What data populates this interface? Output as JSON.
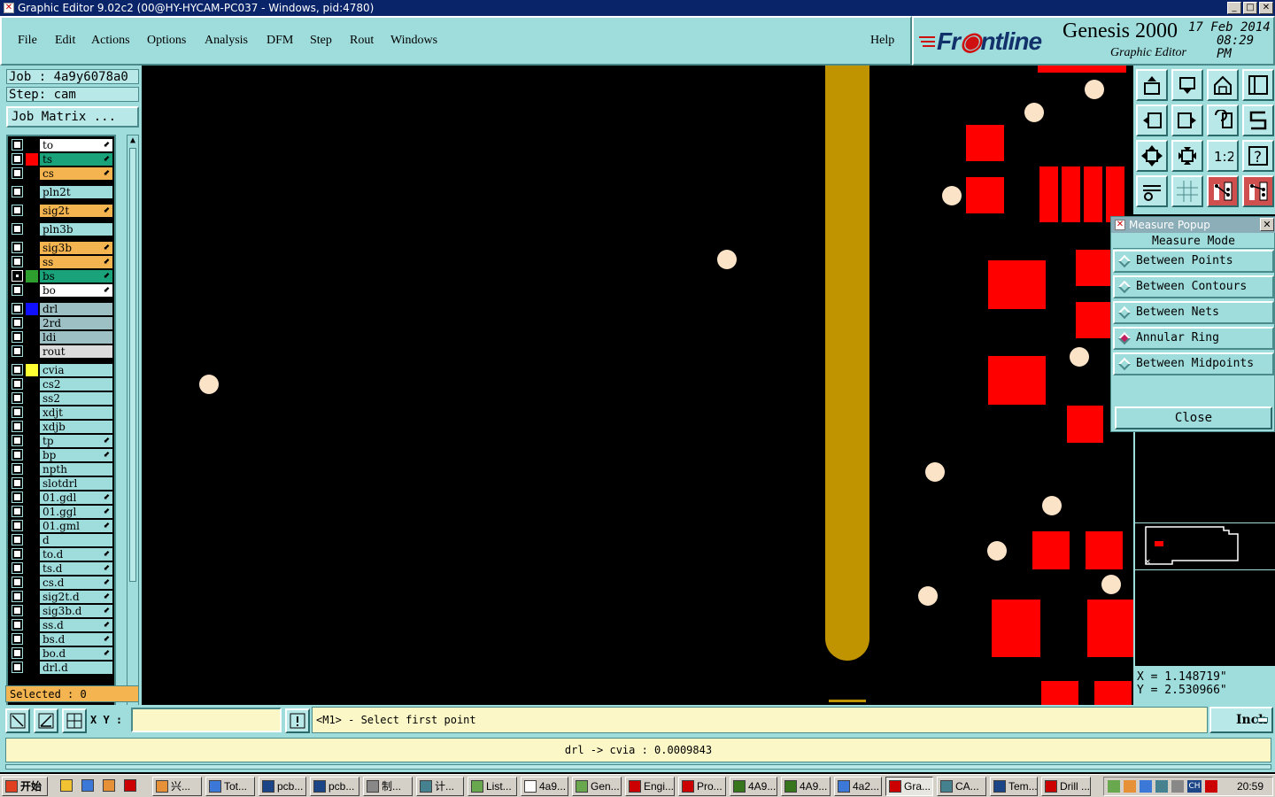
{
  "window": {
    "title": "Graphic Editor 9.02c2 (00@HY-HYCAM-PC037 - Windows, pid:4780)"
  },
  "menu": [
    "File",
    "Edit",
    "Actions",
    "Options",
    "Analysis",
    "DFM",
    "Step",
    "Rout",
    "Windows"
  ],
  "help": "Help",
  "brand": {
    "logo_a": "Fr",
    "logo_b": "ntline",
    "product": "Genesis 2000",
    "subtitle": "Graphic Editor",
    "date": "17 Feb 2014",
    "time": "08:29 PM"
  },
  "job": {
    "job_label": "Job : 4a9y6078a0",
    "step_label": "Step: cam",
    "matrix_button": "Job Matrix ..."
  },
  "layers": [
    {
      "name": "to",
      "color": "#ffffff",
      "swatch": "",
      "arrow": true
    },
    {
      "name": "ts",
      "color": "#1aa37a",
      "swatch": "#ff0000",
      "arrow": true
    },
    {
      "name": "cs",
      "color": "#f4b550",
      "swatch": "",
      "arrow": true
    },
    {
      "name": "pln2t",
      "color": "#9fdcdc",
      "swatch": "",
      "arrow": false
    },
    {
      "name": "sig2t",
      "color": "#f4b550",
      "swatch": "",
      "arrow": true
    },
    {
      "name": "pln3b",
      "color": "#9fdcdc",
      "swatch": "",
      "arrow": false
    },
    {
      "name": "sig3b",
      "color": "#f4b550",
      "swatch": "",
      "arrow": true
    },
    {
      "name": "ss",
      "color": "#f4b550",
      "swatch": "",
      "arrow": true
    },
    {
      "name": "bs",
      "color": "#1aa37a",
      "swatch": "#2e9e2e",
      "arrow": true,
      "checked": true
    },
    {
      "name": "bo",
      "color": "#ffffff",
      "swatch": "",
      "arrow": true
    },
    {
      "name": "drl",
      "color": "#9cc0c4",
      "swatch": "#1010ff",
      "arrow": false
    },
    {
      "name": "2rd",
      "color": "#9cc0c4",
      "swatch": "",
      "arrow": false
    },
    {
      "name": "ldi",
      "color": "#9cc0c4",
      "swatch": "",
      "arrow": false
    },
    {
      "name": "rout",
      "color": "#dcdcdc",
      "swatch": "",
      "arrow": false
    },
    {
      "name": "cvia",
      "color": "#9fdcdc",
      "swatch": "#ffff33",
      "arrow": false
    },
    {
      "name": "cs2",
      "color": "#9fdcdc",
      "swatch": "",
      "arrow": false
    },
    {
      "name": "ss2",
      "color": "#9fdcdc",
      "swatch": "",
      "arrow": false
    },
    {
      "name": "xdjt",
      "color": "#9fdcdc",
      "swatch": "",
      "arrow": false
    },
    {
      "name": "xdjb",
      "color": "#9fdcdc",
      "swatch": "",
      "arrow": false
    },
    {
      "name": "tp",
      "color": "#9fdcdc",
      "swatch": "",
      "arrow": true
    },
    {
      "name": "bp",
      "color": "#9fdcdc",
      "swatch": "",
      "arrow": true
    },
    {
      "name": "npth",
      "color": "#9fdcdc",
      "swatch": "",
      "arrow": false
    },
    {
      "name": "slotdrl",
      "color": "#9fdcdc",
      "swatch": "",
      "arrow": false
    },
    {
      "name": "01.gdl",
      "color": "#9fdcdc",
      "swatch": "",
      "arrow": true
    },
    {
      "name": "01.ggl",
      "color": "#9fdcdc",
      "swatch": "",
      "arrow": true
    },
    {
      "name": "01.gml",
      "color": "#9fdcdc",
      "swatch": "",
      "arrow": true
    },
    {
      "name": "d",
      "color": "#9fdcdc",
      "swatch": "",
      "arrow": false
    },
    {
      "name": "to.d",
      "color": "#9fdcdc",
      "swatch": "",
      "arrow": true
    },
    {
      "name": "ts.d",
      "color": "#9fdcdc",
      "swatch": "",
      "arrow": true
    },
    {
      "name": "cs.d",
      "color": "#9fdcdc",
      "swatch": "",
      "arrow": true
    },
    {
      "name": "sig2t.d",
      "color": "#9fdcdc",
      "swatch": "",
      "arrow": true
    },
    {
      "name": "sig3b.d",
      "color": "#9fdcdc",
      "swatch": "",
      "arrow": true
    },
    {
      "name": "ss.d",
      "color": "#9fdcdc",
      "swatch": "",
      "arrow": true
    },
    {
      "name": "bs.d",
      "color": "#9fdcdc",
      "swatch": "",
      "arrow": true
    },
    {
      "name": "bo.d",
      "color": "#9fdcdc",
      "swatch": "",
      "arrow": true
    },
    {
      "name": "drl.d",
      "color": "#9fdcdc",
      "swatch": "",
      "arrow": false
    }
  ],
  "selected": "Selected : 0",
  "measure": {
    "title": "Measure Popup",
    "mode_label": "Measure Mode",
    "options": [
      "Between Points",
      "Between Contours",
      "Between Nets",
      "Annular Ring",
      "Between Midpoints"
    ],
    "selected_option": "Annular Ring",
    "close": "Close"
  },
  "coords": {
    "x": "X = 1.148719\"",
    "y": "Y = 2.530966\""
  },
  "command": {
    "xy_label": "X Y :",
    "xy_value": "",
    "prompt": "<M1> - Select first point",
    "units": "Inch"
  },
  "status": "drl -> cvia : 0.0009843",
  "taskbar": {
    "start": "开始",
    "tasks": [
      "兴...",
      "Tot...",
      "pcb...",
      "pcb...",
      "制...",
      "计...",
      "List...",
      "4a9...",
      "Gen...",
      "Engi...",
      "Pro...",
      "4A9...",
      "4A9...",
      "4a2...",
      "Gra...",
      "CA...",
      "Tem...",
      "Drill ..."
    ],
    "active": "Gra...",
    "lang": "CH",
    "clock": "20:59"
  },
  "colors": {
    "panel": "#9fdcdc",
    "pad": "#ff0000",
    "trace": "#c09400",
    "via": "#fbe3c8",
    "input": "#fbf7c6"
  },
  "icons": {
    "toolgrid": [
      "export-icon",
      "import-icon",
      "home-icon",
      "panel-icon",
      "left-icon",
      "right-icon",
      "undo-icon",
      "snake-icon",
      "fit-icon",
      "zoom-icon",
      "one-to-one-icon",
      "help-icon",
      "pen-icon",
      "grid-icon",
      "net-a-icon",
      "net-b-icon"
    ]
  }
}
